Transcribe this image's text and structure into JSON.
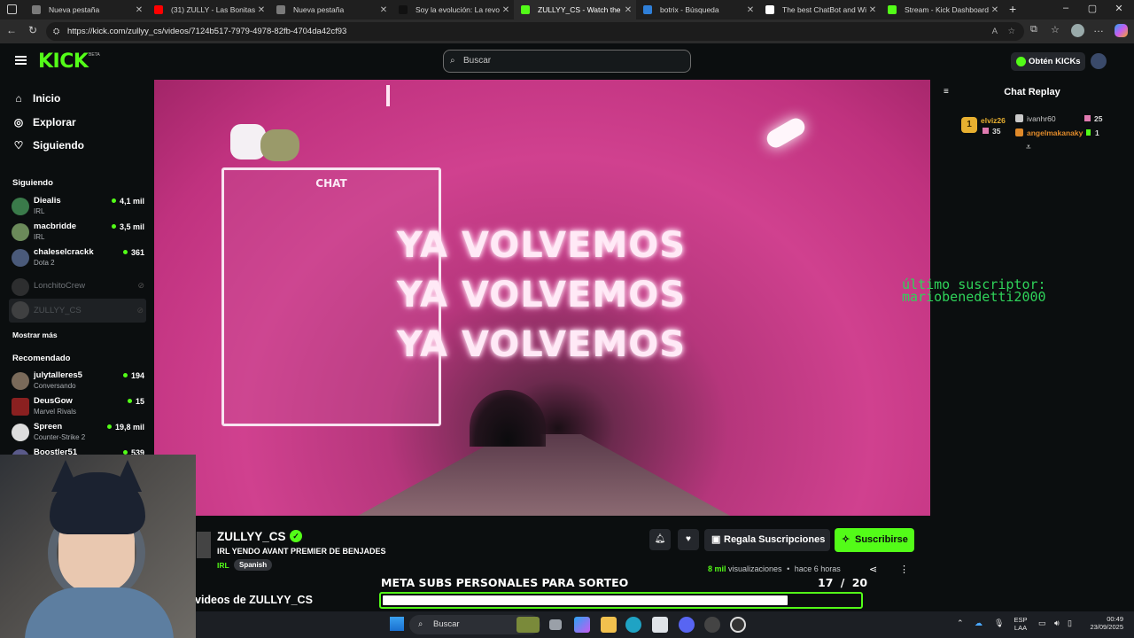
{
  "browser": {
    "tabs": [
      {
        "title": "Nueva pestaña",
        "color": "#7a7a7a"
      },
      {
        "title": "(31) ZULLY - Las Bonitas con",
        "color": "#ff0000"
      },
      {
        "title": "Nueva pestaña",
        "color": "#7a7a7a"
      },
      {
        "title": "Soy la evolución: La revolu",
        "color": "#111111"
      },
      {
        "title": "ZULLYY_CS - Watch the VO",
        "color": "#53fc18"
      },
      {
        "title": "botrix - Búsqueda",
        "color": "#2f7fd8"
      },
      {
        "title": "The best ChatBot and Widg",
        "color": "#ffffff"
      },
      {
        "title": "Stream - Kick Dashboard",
        "color": "#53fc18"
      }
    ],
    "url": "https://kick.com/zullyy_cs/videos/7124b517-7979-4978-82fb-4704da42cf93"
  },
  "header": {
    "logo": "KICK",
    "logo_badge": "BETA",
    "search_placeholder": "Buscar",
    "get_kicks": "Obtén KICKs"
  },
  "sidebar": {
    "nav": [
      {
        "label": "Inicio",
        "icon": "home-icon"
      },
      {
        "label": "Explorar",
        "icon": "compass-icon"
      },
      {
        "label": "Siguiendo",
        "icon": "heart-icon"
      }
    ],
    "following_header": "Siguiendo",
    "following": [
      {
        "name": "Diealis",
        "category": "IRL",
        "viewers": "4,1 mil",
        "avatar": "#3a7a4a"
      },
      {
        "name": "macbridde",
        "category": "IRL",
        "viewers": "3,5 mil",
        "avatar": "#6b8a5a"
      },
      {
        "name": "chaleselcrackk",
        "category": "Dota 2",
        "viewers": "361",
        "avatar": "#4a5a7a"
      },
      {
        "name": "LonchitoCrew",
        "category": "",
        "viewers": "",
        "avatar": "#555555"
      },
      {
        "name": "ZULLYY_CS",
        "category": "",
        "viewers": "",
        "avatar": "#666666"
      }
    ],
    "show_more": "Mostrar más",
    "recommended_header": "Recomendado",
    "recommended": [
      {
        "name": "julytalleres5",
        "category": "Conversando",
        "viewers": "194",
        "avatar": "#7a6a5a"
      },
      {
        "name": "DeusGow",
        "category": "Marvel Rivals",
        "viewers": "15",
        "avatar": "#8a2020"
      },
      {
        "name": "Spreen",
        "category": "Counter-Strike 2",
        "viewers": "19,8 mil",
        "avatar": "#dddddd"
      },
      {
        "name": "Boostler51",
        "category": "",
        "viewers": "539",
        "avatar": "#5a5a8a"
      }
    ]
  },
  "video": {
    "overlay_chat_label": "CHAT",
    "overlay_lines": [
      "YA VOLVEMOS",
      "YA VOLVEMOS",
      "YA VOLVEMOS"
    ],
    "last_sub_label": "último suscriptor:",
    "last_sub_name": "mariobenedetti2000"
  },
  "chat": {
    "title": "Chat Replay",
    "top_gifters": [
      {
        "name": "elviz26",
        "count": "35",
        "color": "#e8b030"
      },
      {
        "name": "ivanhr60",
        "count": "25",
        "color": "#c9c9c9"
      },
      {
        "name": "angelmakanaky",
        "count": "1",
        "color": "#e08a2a"
      }
    ],
    "rank": "1"
  },
  "stream": {
    "name": "ZULLYY_CS",
    "title": "IRL YENDO AVANT PREMIER DE BENJADES",
    "category": "IRL",
    "language": "Spanish",
    "gift_label": "Regala Suscripciones",
    "subscribe_label": "Suscribirse",
    "views": "8 mil",
    "views_label": "visualizaciones",
    "ago": "hace 6 horas"
  },
  "goal": {
    "title": "META SUBS PERSONALES PARA SORTEO",
    "current": "17",
    "separator": "/",
    "target": "20",
    "progress": 0.85
  },
  "videos_heading": "videos de ZULLYY_CS",
  "taskbar": {
    "search": "Buscar",
    "lang_top": "ESP",
    "lang_bottom": "LAA",
    "time": "00:49",
    "date": "23/09/2025"
  }
}
